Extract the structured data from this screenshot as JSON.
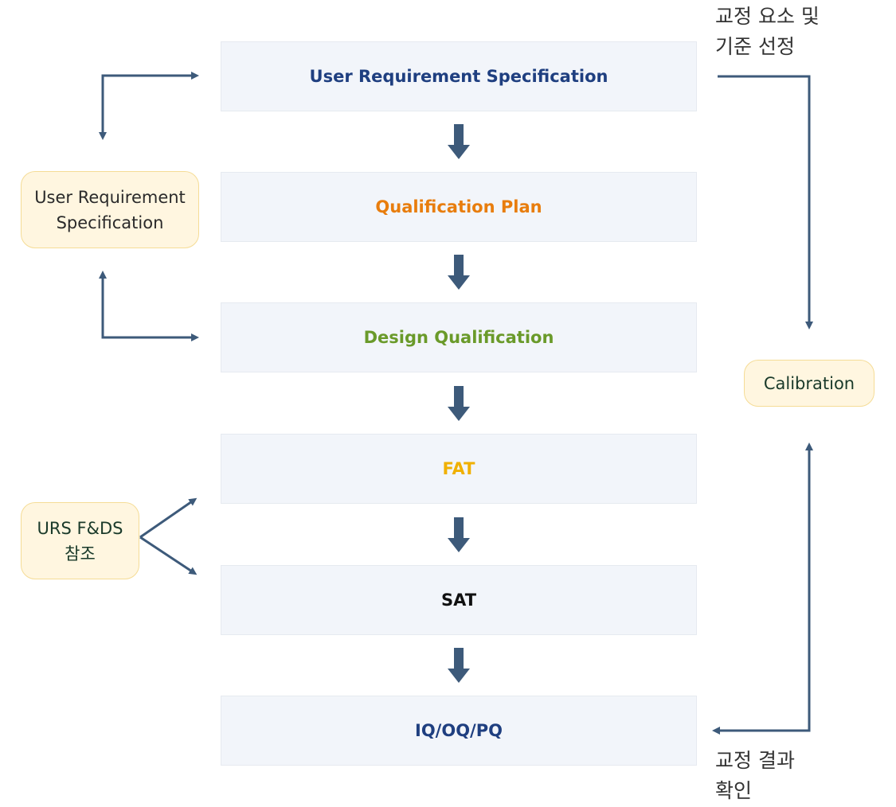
{
  "colors": {
    "arrow": "#3d5a7a",
    "step_bg": "#f2f5fa",
    "side_bg": "#fff6e0",
    "side_border": "#f5dc96"
  },
  "steps": [
    {
      "label": "User Requirement Specification",
      "color": "#1f3f80"
    },
    {
      "label": "Qualification Plan",
      "color": "#e87d0d"
    },
    {
      "label": "Design Qualification",
      "color": "#6a9a2a"
    },
    {
      "label": "FAT",
      "color": "#f0b000"
    },
    {
      "label": "SAT",
      "color": "#111111"
    },
    {
      "label": "IQ/OQ/PQ",
      "color": "#1f3f80"
    }
  ],
  "side": {
    "urs": "User Requirement Specification",
    "urs_fds": "URS F&DS 참조",
    "calibration": "Calibration"
  },
  "notes": {
    "top_right": "교정 요소 및\n기준 선정",
    "bottom_right": "교정 결과\n확인"
  }
}
